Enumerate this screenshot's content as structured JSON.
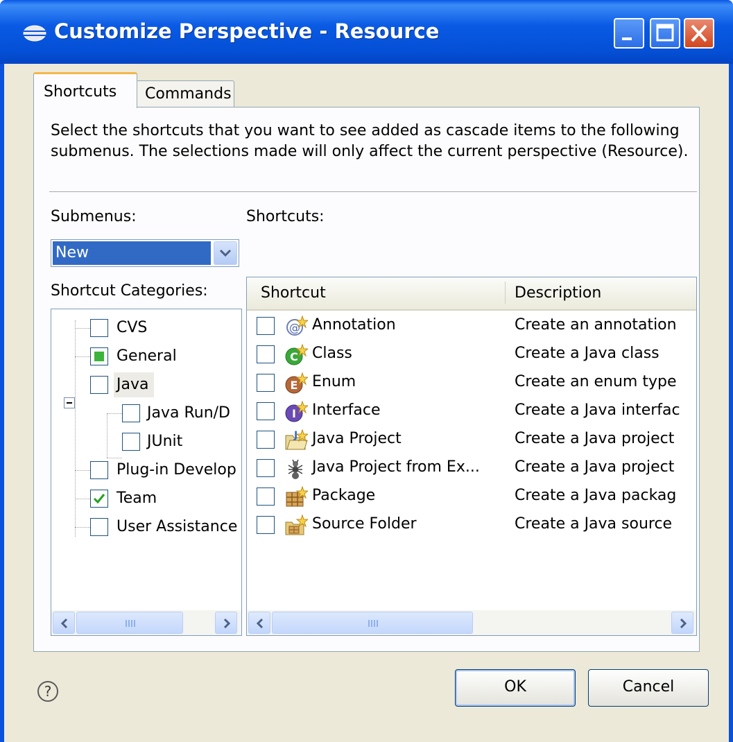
{
  "window": {
    "title": "Customize Perspective - Resource"
  },
  "tabs": [
    {
      "label": "Shortcuts",
      "selected": true
    },
    {
      "label": "Commands",
      "selected": false
    }
  ],
  "instructions": "Select the shortcuts that you want to see added as cascade items to the following submenus.  The selections made will only affect the current perspective (Resource).",
  "submenus": {
    "label": "Submenus:",
    "value": "New"
  },
  "categories": {
    "label": "Shortcut Categories:",
    "items": [
      {
        "label": "CVS",
        "state": "unchecked"
      },
      {
        "label": "General",
        "state": "partial"
      },
      {
        "label": "Java",
        "state": "unchecked",
        "expanded": true
      },
      {
        "label": "Java Run/D",
        "state": "unchecked"
      },
      {
        "label": "JUnit",
        "state": "unchecked"
      },
      {
        "label": "Plug-in Develop",
        "state": "unchecked"
      },
      {
        "label": "Team",
        "state": "checked"
      },
      {
        "label": "User Assistance",
        "state": "unchecked"
      }
    ]
  },
  "shortcuts": {
    "label": "Shortcuts:",
    "columns": [
      "Shortcut",
      "Description"
    ],
    "rows": [
      {
        "name": "Annotation",
        "description": "Create an annotation",
        "icon": "annotation-icon"
      },
      {
        "name": "Class",
        "description": "Create a Java class",
        "icon": "class-icon"
      },
      {
        "name": "Enum",
        "description": "Create an enum type",
        "icon": "enum-icon"
      },
      {
        "name": "Interface",
        "description": "Create a Java interfac",
        "icon": "interface-icon"
      },
      {
        "name": "Java Project",
        "description": "Create a Java project",
        "icon": "java-project-icon"
      },
      {
        "name": "Java Project from Ex...",
        "description": "Create a Java project",
        "icon": "ant-project-icon"
      },
      {
        "name": "Package",
        "description": "Create a Java packag",
        "icon": "package-icon"
      },
      {
        "name": "Source Folder",
        "description": "Create a Java source",
        "icon": "source-folder-icon"
      }
    ]
  },
  "buttons": {
    "help_glyph": "?",
    "ok": "OK",
    "cancel": "Cancel"
  }
}
